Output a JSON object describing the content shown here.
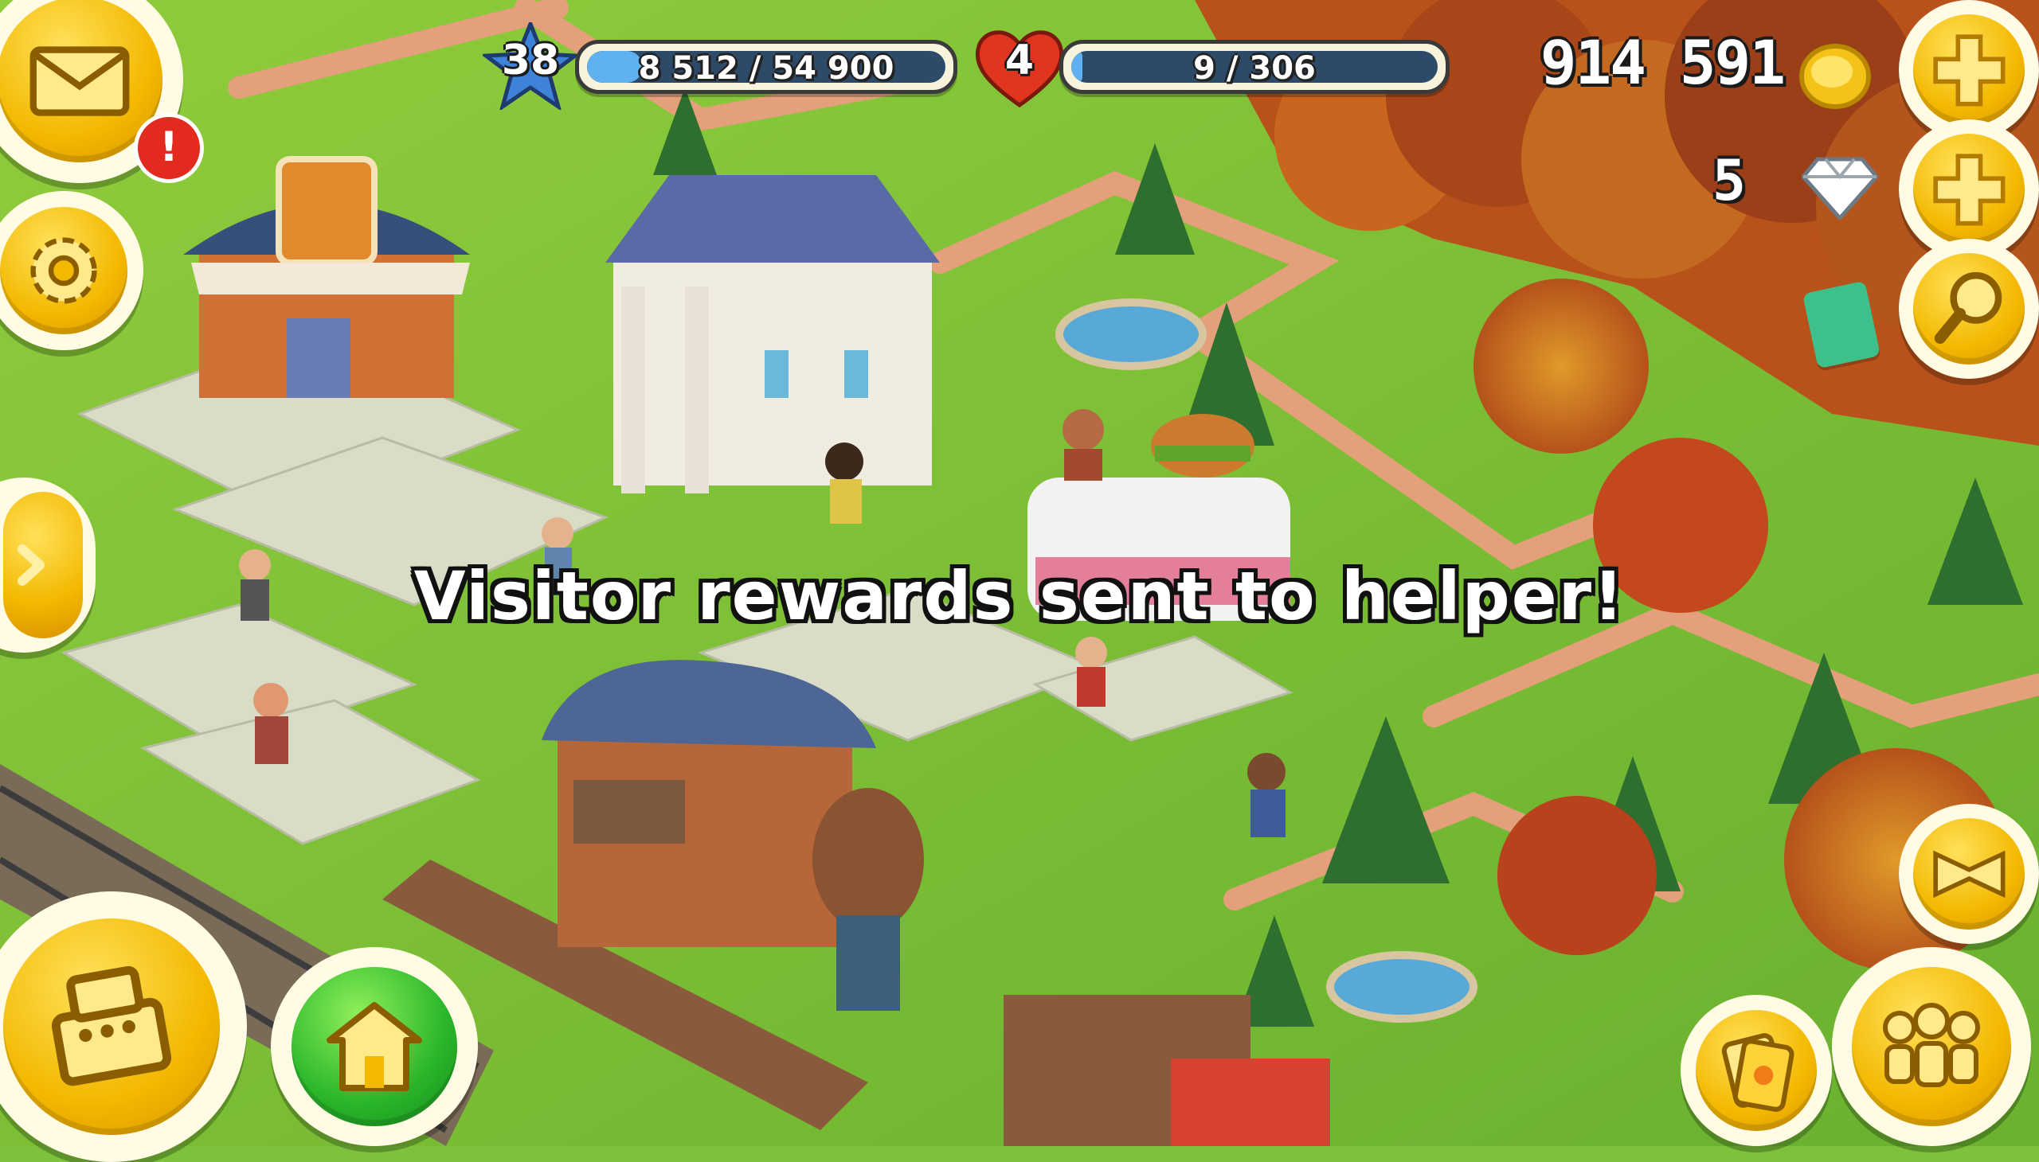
{
  "hud": {
    "level": "38",
    "xp_text": "8 512 / 54 900",
    "xp_progress": 0.155,
    "reputation_level": "4",
    "reputation_text": "9 / 306",
    "reputation_progress": 0.03,
    "coins": "914 591",
    "diamonds": "5",
    "mail_alert": "!"
  },
  "message": "Visitor rewards sent to helper!",
  "icons": [
    "mail-icon",
    "gear-icon",
    "arrow-right-icon",
    "cash-register-icon",
    "home-icon",
    "plus-icon",
    "magnifier-icon",
    "expand-icon",
    "people-icon",
    "cards-icon",
    "coin-icon",
    "diamond-icon",
    "star-icon",
    "heart-icon"
  ],
  "colors": {
    "grass": "#7cc23a",
    "gold": "#f3b800",
    "xp_fill": "#5fb1ef",
    "bar_track": "#2d4a69",
    "green_button": "#29b52a",
    "alert_red": "#e22a1e"
  }
}
